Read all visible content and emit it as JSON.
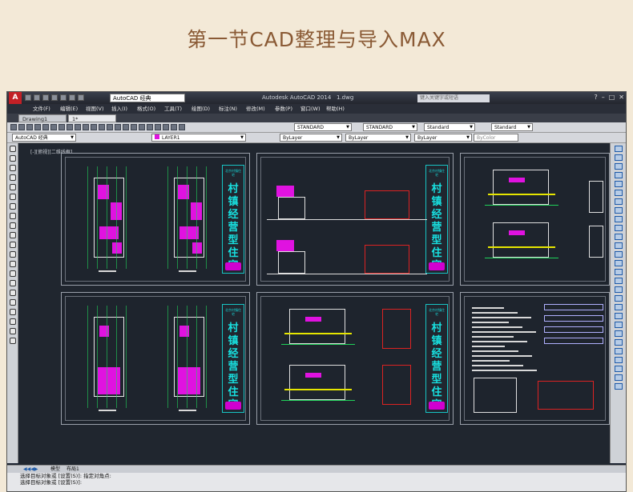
{
  "banner": {
    "title": "第一节CAD整理与导入MAX"
  },
  "window": {
    "logo": "A",
    "workspace": "AutoCAD 经典",
    "app_title": "Autodesk AutoCAD 2014",
    "file_name": "1.dwg",
    "search_placeholder": "键入关键字或短语"
  },
  "menu": [
    "文件(F)",
    "编辑(E)",
    "视图(V)",
    "插入(I)",
    "格式(O)",
    "工具(T)",
    "绘图(D)",
    "标注(N)",
    "修改(M)",
    "参数(P)",
    "窗口(W)",
    "帮助(H)"
  ],
  "tabs": [
    {
      "label": "Drawing1"
    },
    {
      "label": "1*"
    }
  ],
  "styles": {
    "text_style": "STANDARD",
    "dim_style": "STANDARD",
    "table_style": "Standard",
    "mleader_style": "Standard"
  },
  "layers": {
    "workspace": "AutoCAD 经典",
    "current": "LAYER1"
  },
  "properties": {
    "color": "ByLayer",
    "linetype": "ByLayer",
    "lineweight": "ByLayer",
    "plotstyle": "ByColor"
  },
  "viewport_label": "[-][俯视][二维线框]",
  "sheet_titles": {
    "caption": "北京村镇住宅",
    "vertical": "村镇经营型住宅"
  },
  "layout_tabs": [
    "模型",
    "布局1"
  ],
  "command_lines": [
    "选择目标对象或 [设置(S)]: 指定对角点:",
    "选择目标对象或 [设置(S)]:"
  ],
  "colors": {
    "accent": "#e012e0",
    "cyan": "#18d0d0",
    "grid": "#1fd35a",
    "banner_text": "#8a5a35"
  }
}
